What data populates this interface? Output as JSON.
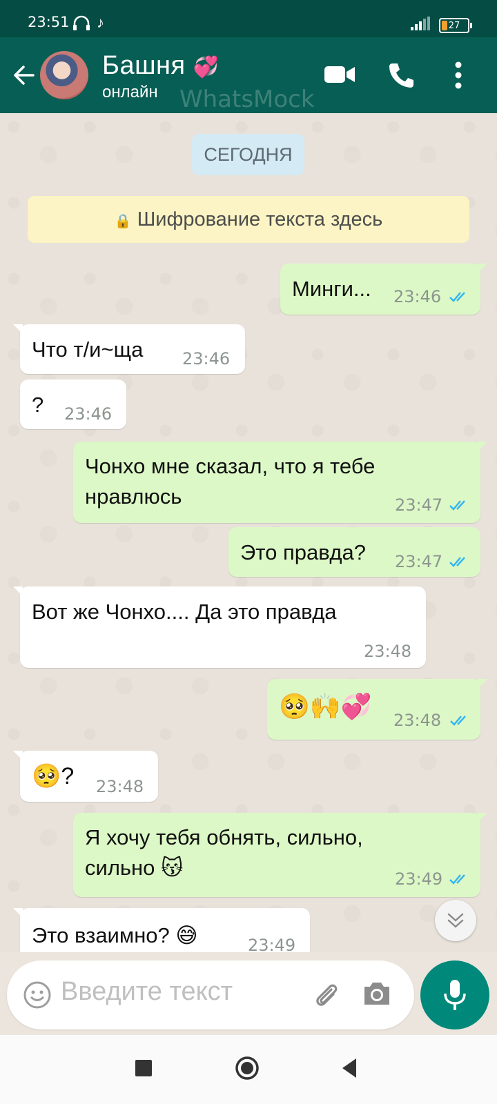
{
  "status_bar": {
    "time": "23:51",
    "battery": "27"
  },
  "header": {
    "contact_name": "Башня",
    "contact_status": "онлайн",
    "watermark": "WhatsMock",
    "icons": [
      "back-arrow-icon",
      "video-call-icon",
      "phone-icon",
      "more-vert-icon"
    ]
  },
  "chat": {
    "date_chip": "СЕГОДНЯ",
    "encryption_notice": "Шифрование текста здесь",
    "messages": [
      {
        "direction": "out",
        "text": "Минги...",
        "time": "23:46",
        "status": "read"
      },
      {
        "direction": "in",
        "text": "Что т/и~ща",
        "time": "23:46"
      },
      {
        "direction": "in",
        "text": "?",
        "time": "23:46"
      },
      {
        "direction": "out",
        "text": "Чонхо мне сказал, что я тебе нравлюсь",
        "line1": "Чонхо мне сказал, что я тебе",
        "line2": "нравлюсь",
        "time": "23:47",
        "status": "read"
      },
      {
        "direction": "out",
        "text": "Это правда?",
        "time": "23:47",
        "status": "read"
      },
      {
        "direction": "in",
        "text": "Вот же Чонхо.... Да это правда",
        "time": "23:48"
      },
      {
        "direction": "out",
        "text": "🥺🙌💞",
        "time": "23:48",
        "status": "read"
      },
      {
        "direction": "in",
        "text": "🥺?",
        "time": "23:48"
      },
      {
        "direction": "out",
        "text": "Я хочу тебя обнять, сильно, сильно 😽",
        "line1": "Я хочу тебя обнять, сильно,",
        "line2": "сильно 😽",
        "time": "23:49",
        "status": "read"
      },
      {
        "direction": "in",
        "text": "Это взаимно? 😅",
        "time": "23:49"
      }
    ]
  },
  "input": {
    "placeholder": "Введите текст",
    "icons": [
      "emoji-icon",
      "attach-icon",
      "camera-icon",
      "mic-icon"
    ]
  },
  "colors": {
    "header": "#075e54",
    "status_bar": "#054d44",
    "outgoing_bubble": "#dcf8c6",
    "incoming_bubble": "#ffffff",
    "read_ticks": "#34b7f1",
    "mic_button": "#00897b"
  }
}
